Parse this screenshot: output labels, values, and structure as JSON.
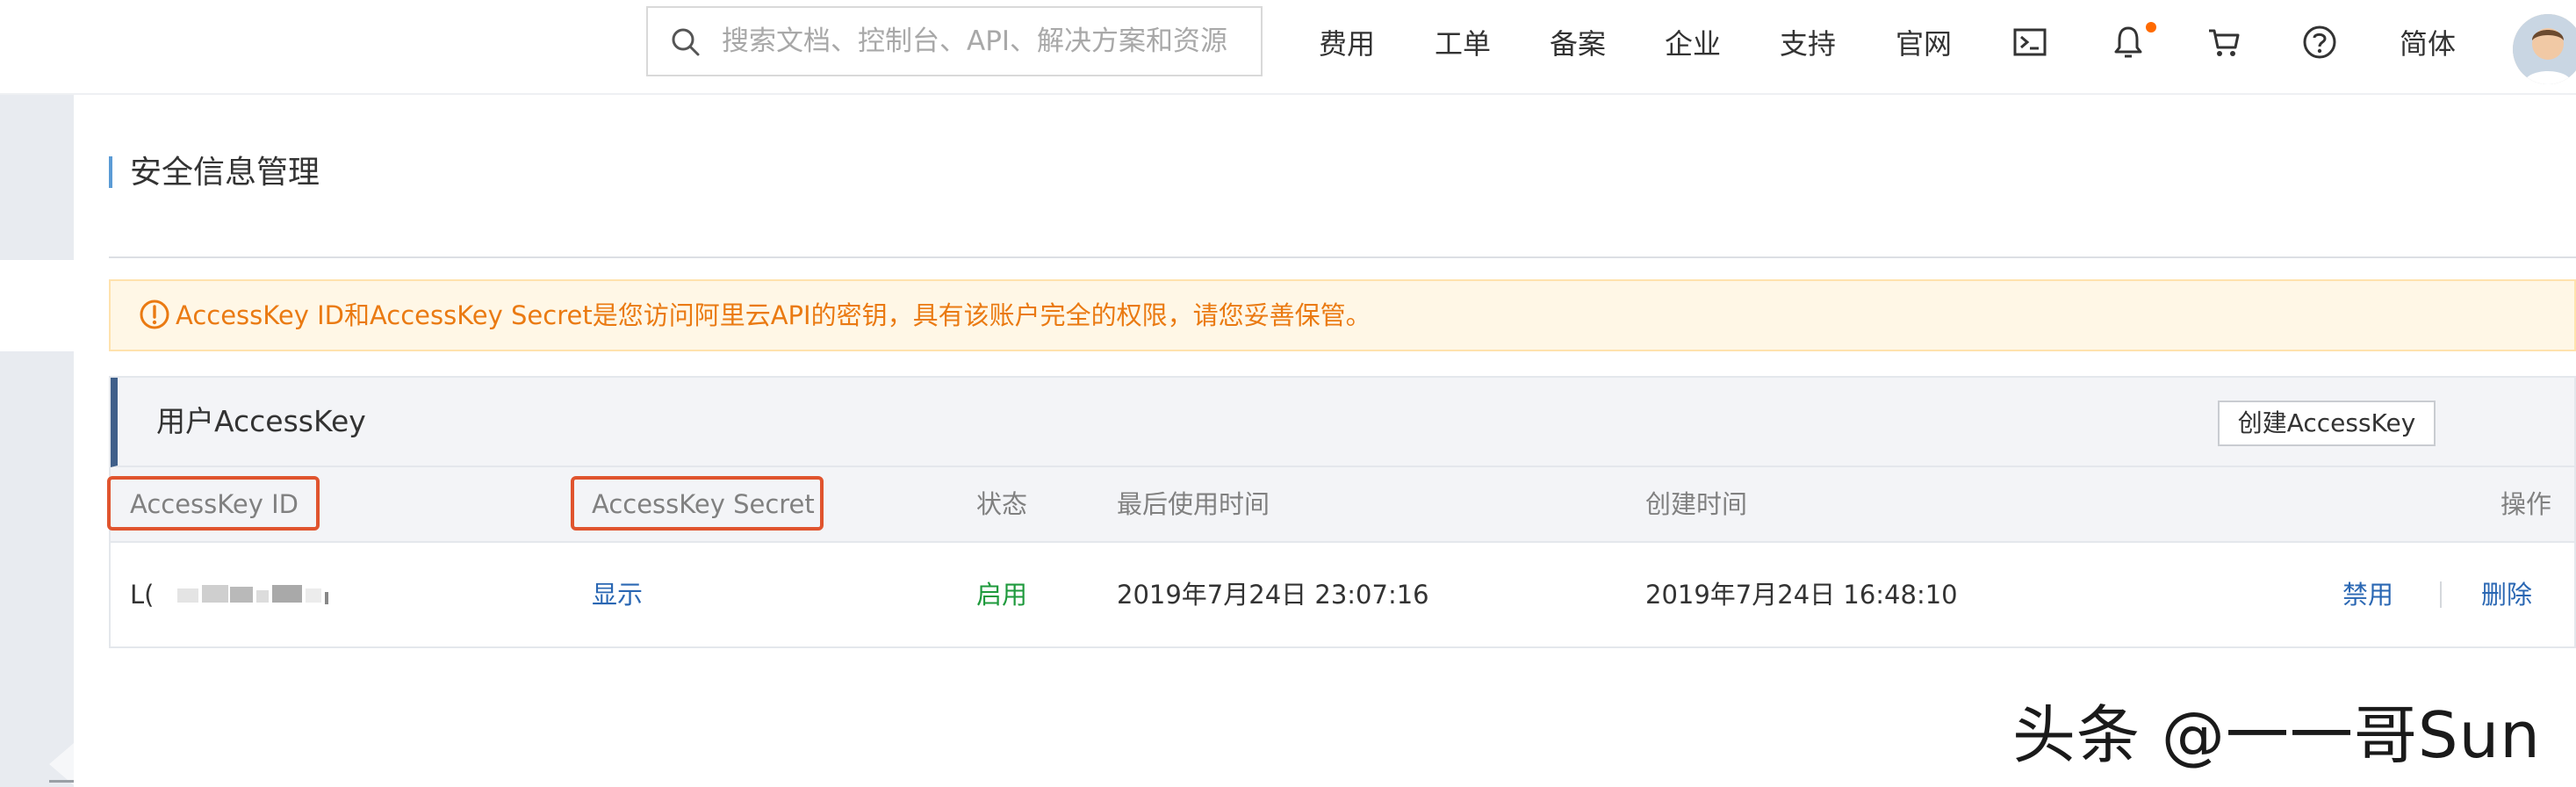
{
  "topbar": {
    "search_placeholder": "搜索文档、控制台、API、解决方案和资源",
    "nav": [
      "费用",
      "工单",
      "备案",
      "企业",
      "支持",
      "官网"
    ],
    "icons": [
      "terminal-icon",
      "bell-icon",
      "cart-icon",
      "help-icon"
    ],
    "language": "简体",
    "notification_dot_color": "#ff6a00"
  },
  "page": {
    "title": "安全信息管理"
  },
  "notice": {
    "icon": "warning-circle-icon",
    "text": "AccessKey ID和AccessKey Secret是您访问阿里云API的密钥，具有该账户完全的权限，请您妥善保管。",
    "color": "#ea7a12"
  },
  "panel": {
    "title": "用户AccessKey",
    "create_button": "创建AccessKey",
    "columns": {
      "id": "AccessKey ID",
      "secret": "AccessKey Secret",
      "status": "状态",
      "last_used": "最后使用时间",
      "created": "创建时间",
      "actions": "操作"
    },
    "rows": [
      {
        "id": "L(",
        "secret_action": "显示",
        "status": "启用",
        "last_used": "2019年7月24日 23:07:16",
        "created": "2019年7月24日 16:48:10",
        "disable": "禁用",
        "delete": "删除"
      }
    ]
  },
  "watermark": "头条 @一一哥Sun"
}
